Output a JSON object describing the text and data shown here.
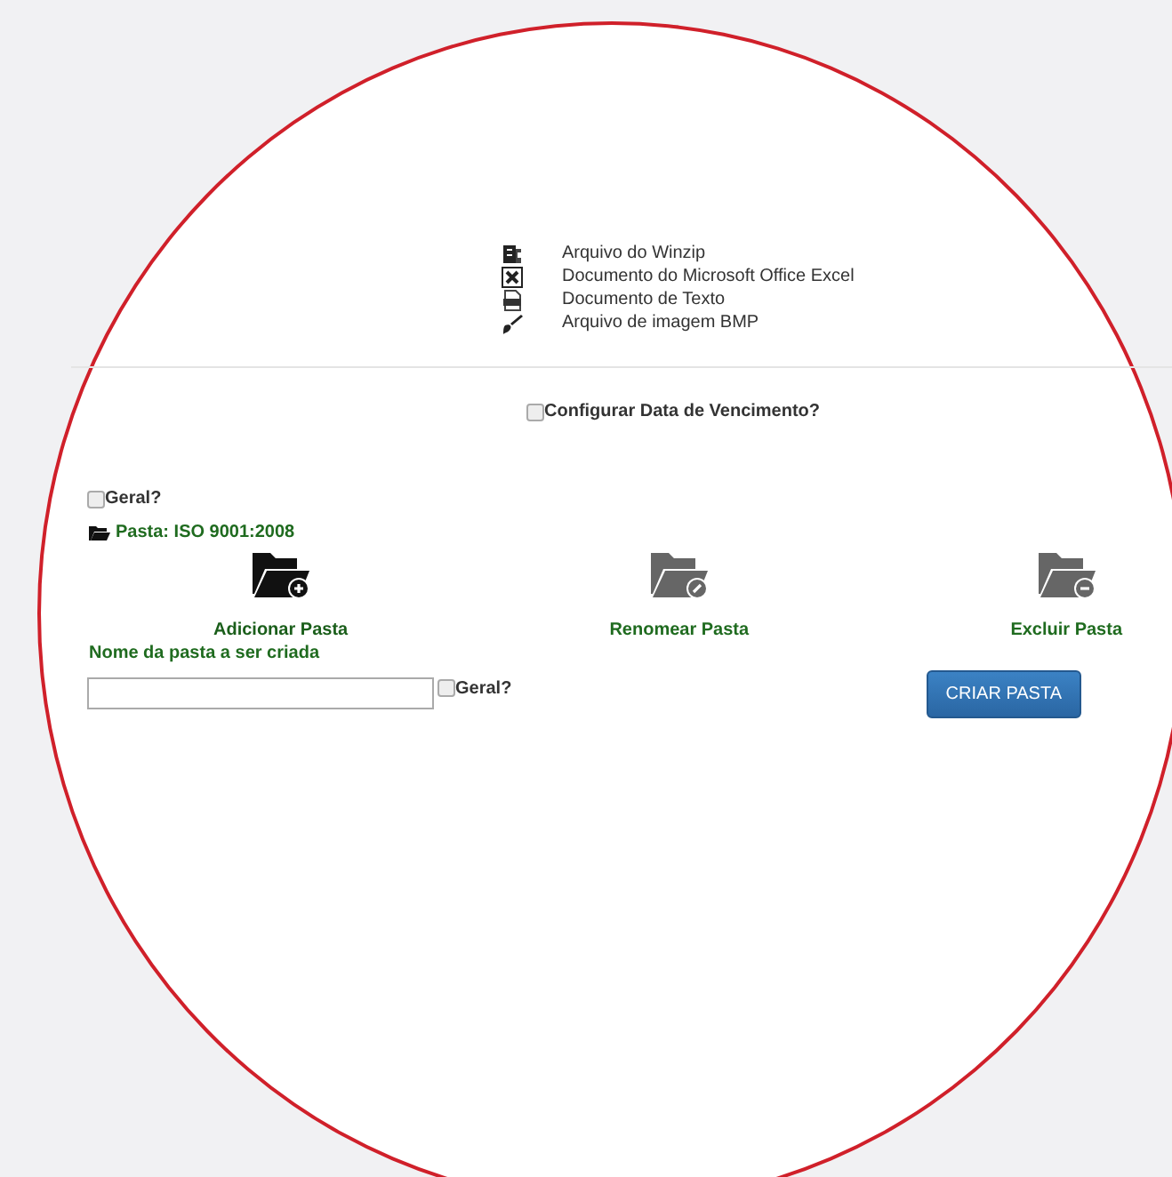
{
  "file_types": [
    {
      "kind": "zip",
      "label": "Arquivo do Winzip"
    },
    {
      "kind": "excel",
      "label": "Documento do Microsoft Office Excel"
    },
    {
      "kind": "text",
      "label": "Documento de Texto"
    },
    {
      "kind": "image",
      "label": "Arquivo de imagem BMP"
    }
  ],
  "due_date_option": {
    "label": "Configurar Data de Vencimento?",
    "checked": false
  },
  "general_option": {
    "label": "Geral?",
    "checked": false
  },
  "current_folder": "Pasta: ISO 9001:2008",
  "actions": [
    {
      "kind": "add",
      "label": "Adicionar Pasta",
      "selected": true
    },
    {
      "kind": "rename",
      "label": "Renomear Pasta",
      "selected": false
    },
    {
      "kind": "delete",
      "label": "Excluir Pasta",
      "selected": false
    }
  ],
  "new_folder": {
    "label": "Nome da pasta a ser criada",
    "general": {
      "label": "Geral?",
      "checked": false
    },
    "button": "CRIAR PASTA"
  }
}
